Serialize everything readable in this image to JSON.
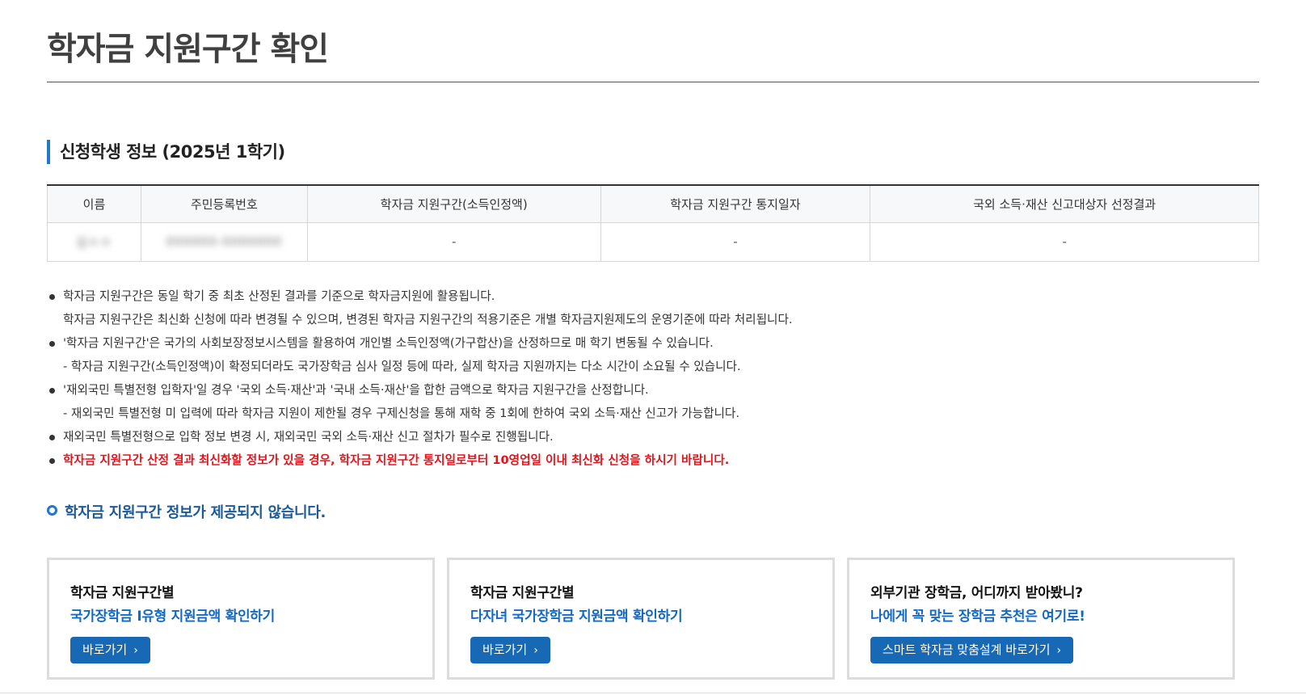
{
  "page_title": "학자금 지원구간 확인",
  "section_title": "신청학생 정보 (2025년 1학기)",
  "table": {
    "headers": [
      "이름",
      "주민등록번호",
      "학자금 지원구간(소득인정액)",
      "학자금 지원구간 통지일자",
      "국외 소득·재산 신고대상자 선정결과"
    ],
    "row": {
      "name": "김ㅇㅇ",
      "rrn": "000000-0000000",
      "bracket": "-",
      "notice_date": "-",
      "overseas_result": "-"
    }
  },
  "notes": [
    {
      "type": "bullet",
      "text": "학자금 지원구간은 동일 학기 중 최초 산정된 결과를 기준으로 학자금지원에 활용됩니다."
    },
    {
      "type": "plain",
      "text": "학자금 지원구간은 최신화 신청에 따라 변경될 수 있으며, 변경된 학자금 지원구간의 적용기준은 개별 학자금지원제도의 운영기준에 따라 처리됩니다."
    },
    {
      "type": "bullet",
      "text": "'학자금 지원구간'은 국가의 사회보장정보시스템을 활용하여 개인별 소득인정액(가구합산)을 산정하므로 매 학기 변동될 수 있습니다."
    },
    {
      "type": "plain",
      "text": "- 학자금 지원구간(소득인정액)이 확정되더라도 국가장학금 심사 일정 등에 따라, 실제 학자금 지원까지는 다소 시간이 소요될 수 있습니다."
    },
    {
      "type": "bullet",
      "text": "'재외국민 특별전형 입학자'일 경우 '국외 소득·재산'과 '국내 소득·재산'을 합한 금액으로 학자금 지원구간을 산정합니다."
    },
    {
      "type": "plain",
      "text": "- 재외국민 특별전형 미 입력에 따라 학자금 지원이 제한될 경우 구제신청을 통해 재학 중 1회에 한하여 국외 소득·재산 신고가 가능합니다."
    },
    {
      "type": "bullet",
      "text": "재외국민 특별전형으로 입학 정보 변경 시, 재외국민 국외 소득·재산 신고 절차가 필수로 진행됩니다."
    },
    {
      "type": "red",
      "text": "학자금 지원구간 산정 결과 최신화할 정보가 있을 경우, 학자금 지원구간 통지일로부터 10영업일 이내 최신화 신청을 하시기 바랍니다."
    }
  ],
  "notice": "학자금 지원구간 정보가 제공되지 않습니다.",
  "cards": [
    {
      "line1": "학자금 지원구간별",
      "line2": "국가장학금 Ⅰ유형 지원금액 확인하기",
      "button": "바로가기"
    },
    {
      "line1": "학자금 지원구간별",
      "line2": "다자녀 국가장학금 지원금액 확인하기",
      "button": "바로가기"
    },
    {
      "line1": "외부기관 장학금, 어디까지 받아봤니?",
      "line2": "나에게 꼭 맞는 장학금 추천은 여기로!",
      "button": "스마트 학자금 맞춤설계 바로가기"
    }
  ],
  "colors": {
    "accent": "#1f78c8",
    "button": "#1869b5",
    "warning": "#e3131b",
    "link_text": "#1469c2"
  }
}
